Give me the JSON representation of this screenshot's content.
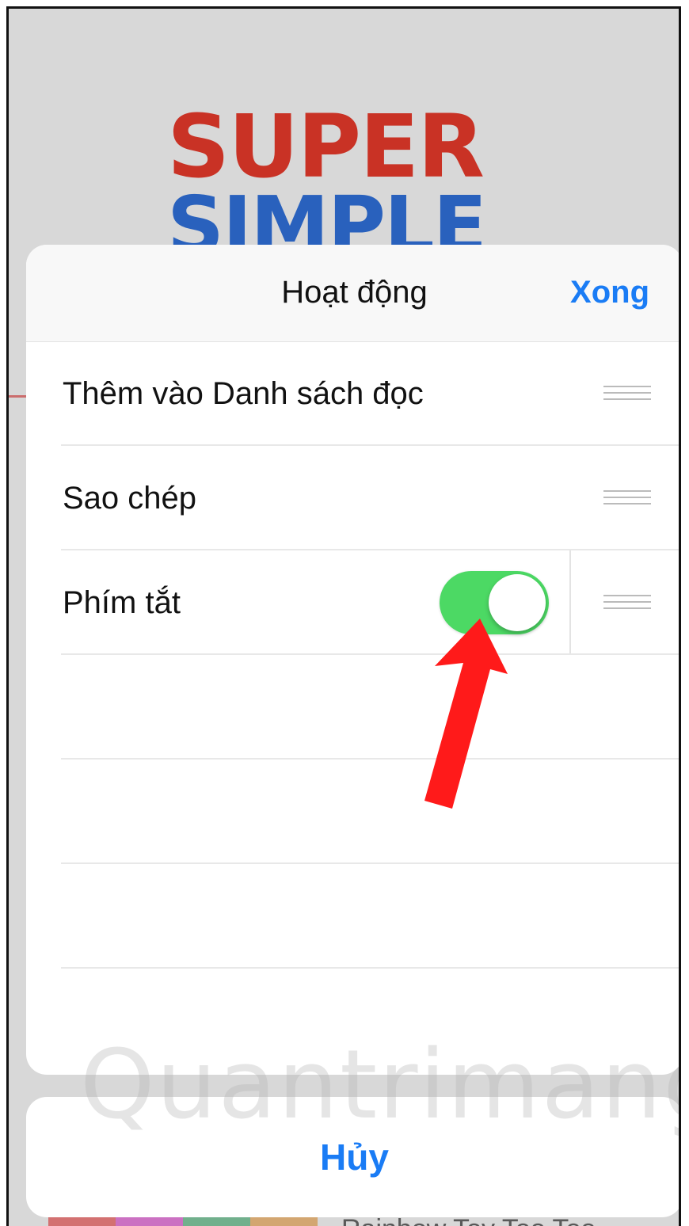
{
  "background": {
    "logo_lines": [
      "SUPER",
      "SIMPLE"
    ],
    "bottom_text": "Rainbow Toy Too Too",
    "colors": {
      "red": "#e53a2b",
      "blue": "#2f6fd8",
      "green": "#38a84a",
      "yellow": "#f5c533",
      "purple": "#6a3aa8"
    }
  },
  "sheet": {
    "title": "Hoạt động",
    "done_label": "Xong",
    "rows": [
      {
        "label": "Thêm vào Danh sách đọc",
        "has_toggle": false
      },
      {
        "label": "Sao chép",
        "has_toggle": false
      },
      {
        "label": "Phím tắt",
        "has_toggle": true,
        "toggle_on": true
      }
    ],
    "empty_rows": 3
  },
  "cancel_label": "Hủy",
  "watermark": "Quantrimang",
  "annotation": {
    "arrow_color": "#ff1a1a"
  },
  "colors": {
    "accent": "#1a7cf5",
    "toggle_on": "#4cd964"
  }
}
